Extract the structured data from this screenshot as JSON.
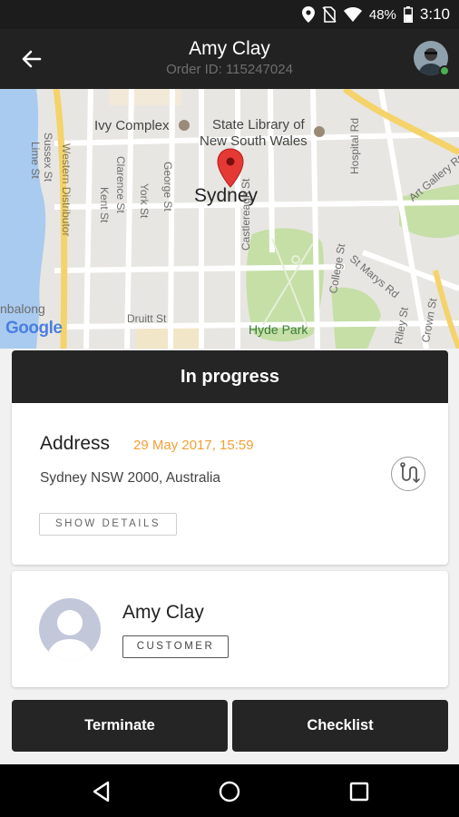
{
  "status_bar": {
    "battery": "48%",
    "time": "3:10"
  },
  "header": {
    "title": "Amy Clay",
    "order_id": "Order ID: 115247024"
  },
  "map": {
    "city": "Sydney",
    "attribution": "Google",
    "labels": {
      "ivy": "Ivy Complex",
      "library_line1": "State Library of",
      "library_line2": "New South Wales",
      "hyde_park": "Hyde Park",
      "sussex": "Sussex St",
      "lime": "Lime St",
      "western": "Western Distributor",
      "clarence": "Clarence St",
      "kent": "Kent St",
      "york": "York St",
      "george": "George St",
      "castlereagh": "Castlereagh St",
      "college": "College St",
      "hospital": "Hospital Rd",
      "art_gallery": "Art Gallery Rd",
      "st_marys": "St Marys Rd",
      "riley": "Riley St",
      "crown": "Crown St",
      "druitt": "Druitt St",
      "barangaroo": "nbalong"
    }
  },
  "order": {
    "status": "In progress",
    "address_title": "Address",
    "date": "29 May 2017, 15:59",
    "address": "Sydney NSW 2000, Australia",
    "show_details": "SHOW DETAILS"
  },
  "customer": {
    "name": "Amy Clay",
    "role": "CUSTOMER"
  },
  "actions": {
    "terminate": "Terminate",
    "checklist": "Checklist"
  }
}
